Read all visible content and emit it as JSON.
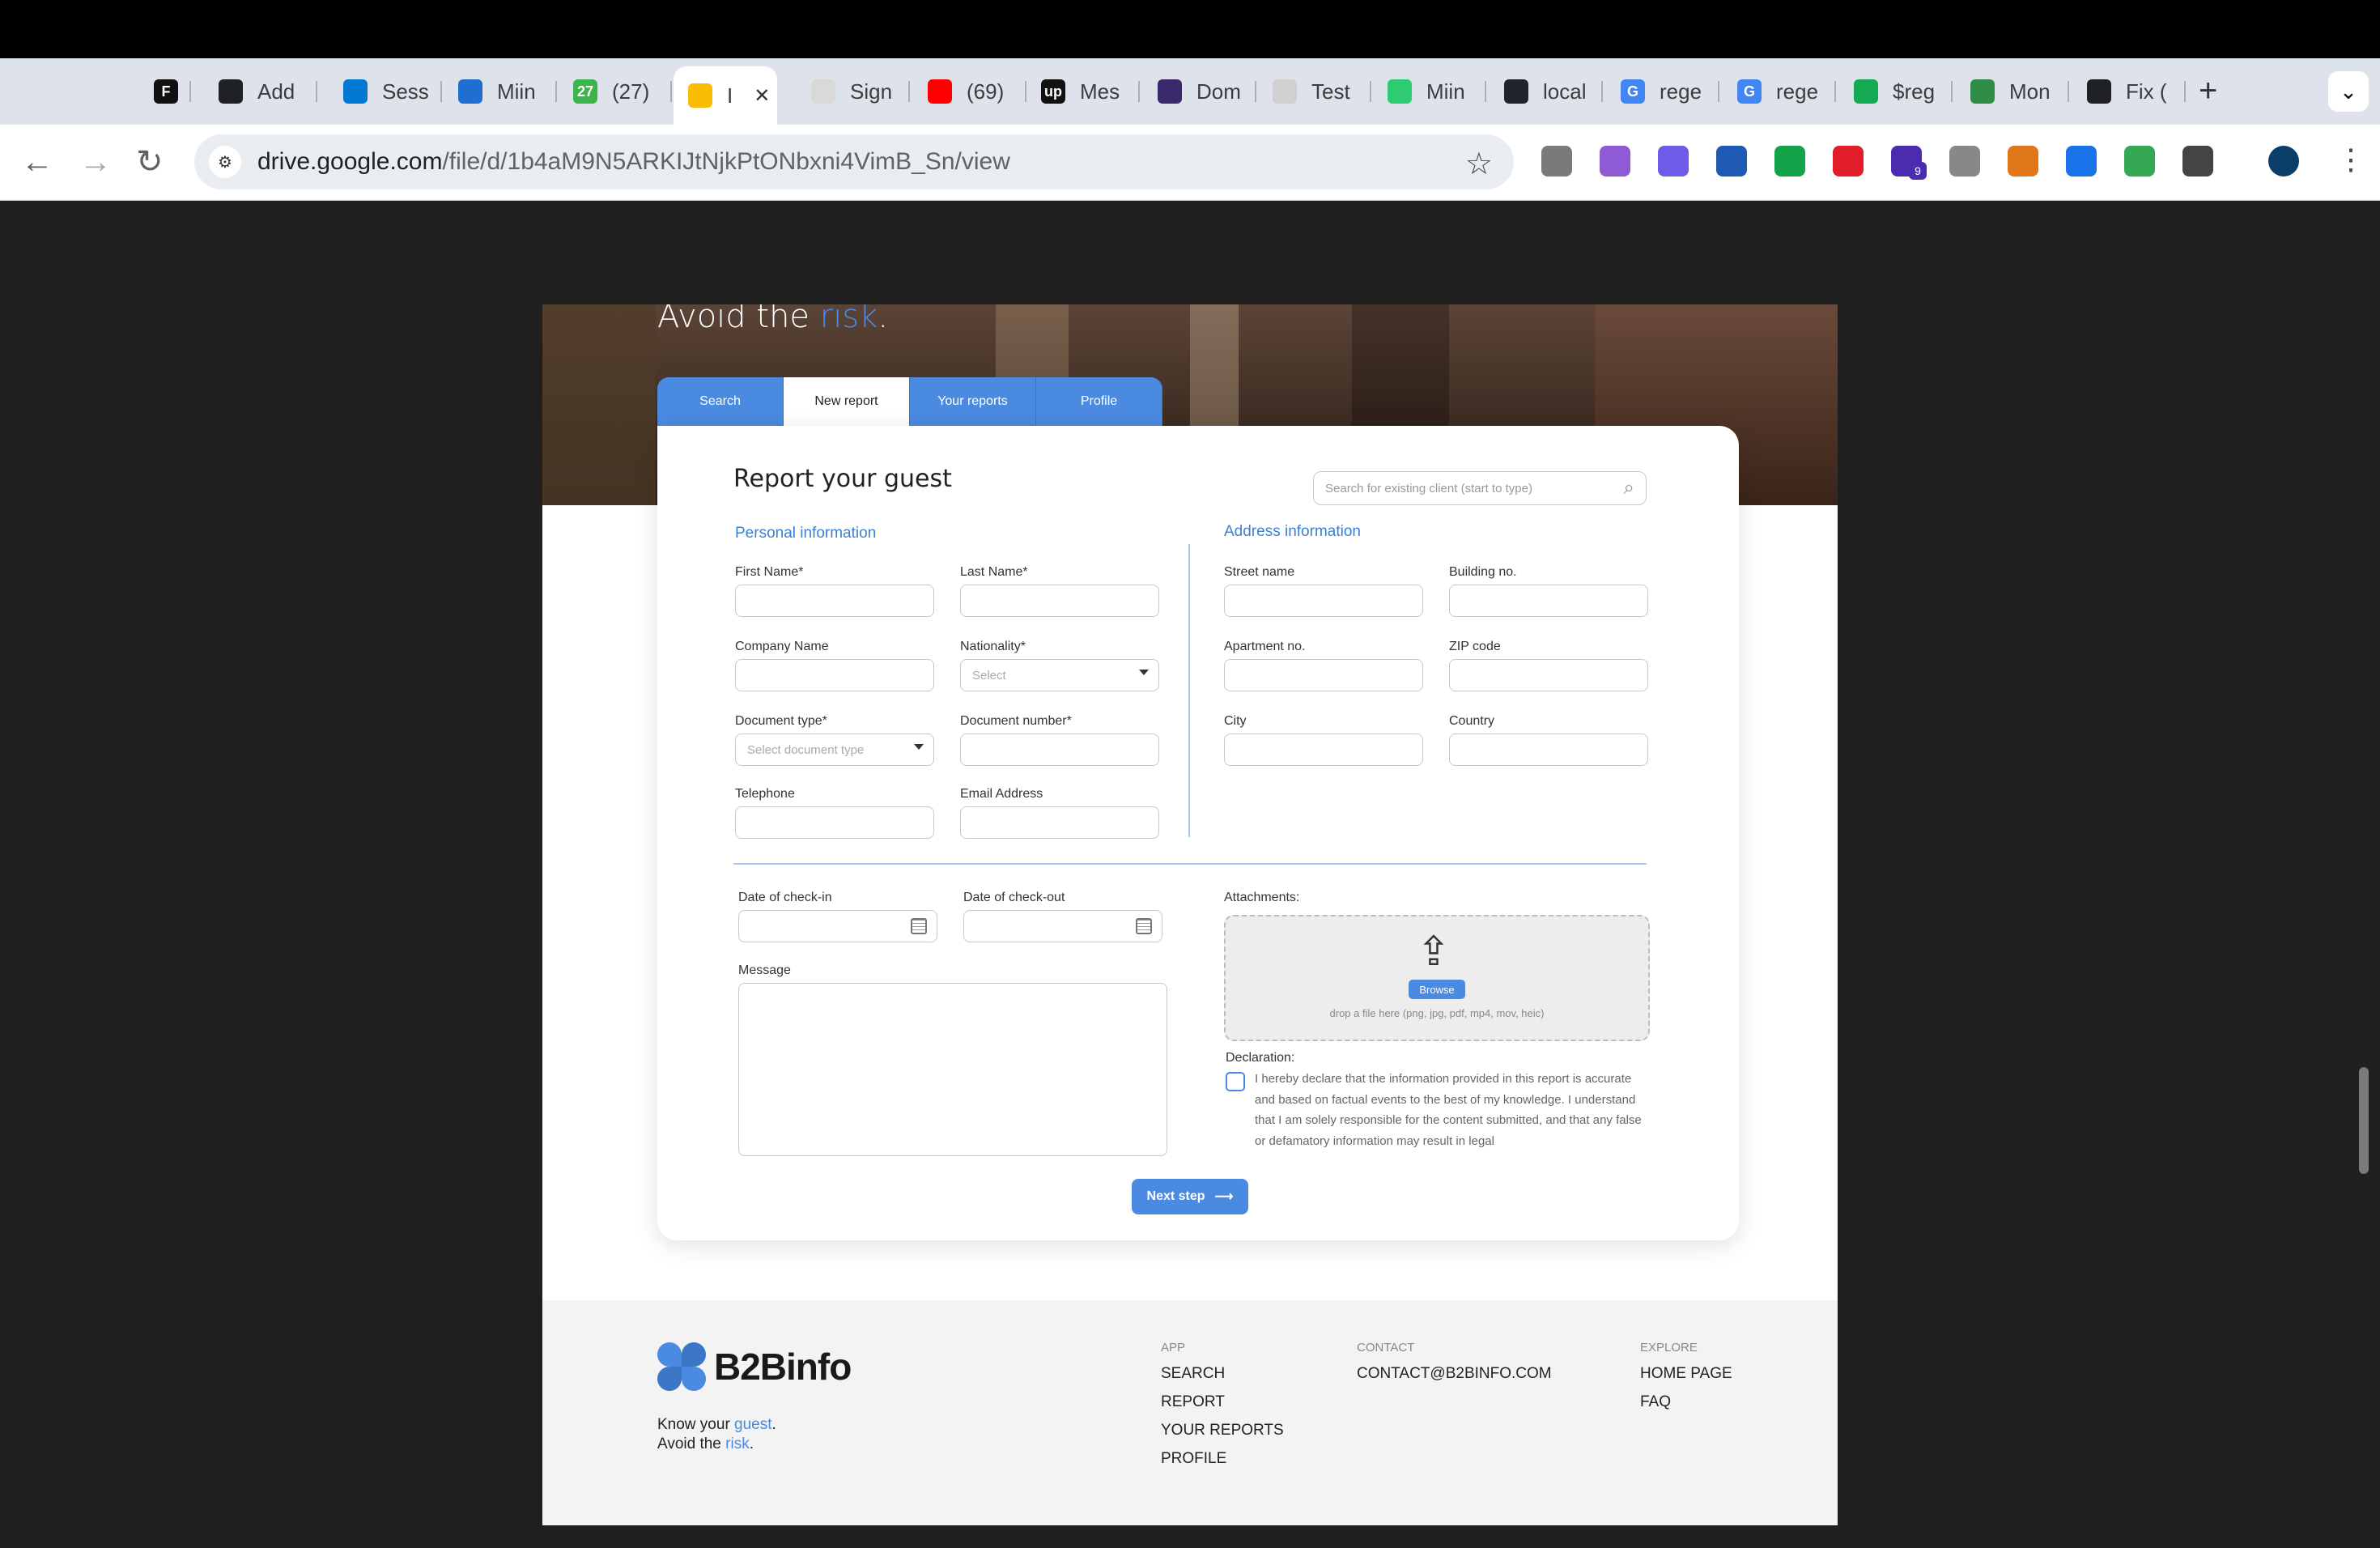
{
  "browser": {
    "tabs": [
      {
        "label": "",
        "favicon": "F",
        "color": "#111111"
      },
      {
        "label": "Add",
        "favicon": "chatgpt-icon",
        "color": "#202124"
      },
      {
        "label": "Sess",
        "favicon": "azure-icon",
        "color": "#0078d4"
      },
      {
        "label": "Miin",
        "favicon": "azure-devops-icon",
        "color": "#1e6fcf"
      },
      {
        "label": "(27)",
        "favicon": "27",
        "color": "#3bb54a"
      },
      {
        "label": "I",
        "favicon": "google-drive-icon",
        "color": "#fbbc04"
      },
      {
        "label": "Sign",
        "favicon": "sign-icon",
        "color": "#d9d9d9"
      },
      {
        "label": "(69)",
        "favicon": "youtube-icon",
        "color": "#ff0000"
      },
      {
        "label": "Mes",
        "favicon": "up",
        "color": "#111111"
      },
      {
        "label": "Dom",
        "favicon": "domain-icon",
        "color": "#3a2a6b"
      },
      {
        "label": "Test",
        "favicon": "test-icon",
        "color": "#d0d0d0"
      },
      {
        "label": "Miin",
        "favicon": "miin-icon",
        "color": "#2ecc71"
      },
      {
        "label": "local",
        "favicon": "react-icon",
        "color": "#20232a"
      },
      {
        "label": "rege",
        "favicon": "G",
        "color": "#4285f4"
      },
      {
        "label": "rege",
        "favicon": "G",
        "color": "#4285f4"
      },
      {
        "label": "$reg",
        "favicon": "mongodb-icon",
        "color": "#13aa52"
      },
      {
        "label": "Mon",
        "favicon": "geeks-icon",
        "color": "#2f8d46"
      },
      {
        "label": "Fix (",
        "favicon": "chatgpt-icon",
        "color": "#202124"
      }
    ],
    "active_tab_close": "✕",
    "new_tab": "+",
    "tab_menu": "⌄",
    "url_domain": "drive.google.com",
    "url_path": "/file/d/1b4aM9N5ARKIJtNjkPtONbxni4VimB_Sn/view",
    "extension_badge": "9"
  },
  "hero": {
    "tagline_prefix": "Avoid the ",
    "tagline_risk": "risk",
    "tagline_suffix": "."
  },
  "tabs": {
    "search": "Search",
    "new_report": "New report",
    "your_reports": "Your reports",
    "profile": "Profile"
  },
  "form": {
    "title": "Report your guest",
    "client_search_placeholder": "Search for existing client (start to type)",
    "personal_heading": "Personal information",
    "address_heading": "Address information",
    "first_name": "First Name*",
    "last_name": "Last Name*",
    "company_name": "Company Name",
    "nationality": "Nationality*",
    "nationality_placeholder": "Select",
    "document_type": "Document type*",
    "document_type_placeholder": "Select document type",
    "document_number": "Document number*",
    "telephone": "Telephone",
    "email": "Email Address",
    "street": "Street name",
    "building": "Building no.",
    "apartment": "Apartment no.",
    "zip": "ZIP code",
    "city": "City",
    "country": "Country",
    "checkin": "Date of check-in",
    "checkout": "Date of check-out",
    "message": "Message",
    "attachments": "Attachments:",
    "browse": "Browse",
    "drop_hint": "drop a file here (png, jpg, pdf, mp4, mov, heic)",
    "declaration": "Declaration:",
    "declaration_text": "I hereby declare that the information provided in this report is accurate and based on factual events to the best of my knowledge. I understand that I am solely responsible for the content submitted, and that any false or defamatory information may result in legal",
    "next_step": "Next step"
  },
  "footer": {
    "brand": "B2Binfo",
    "tag_line1_prefix": "Know your ",
    "tag_line1_hl": "guest",
    "tag_line1_suffix": ".",
    "tag_line2_prefix": "Avoid the ",
    "tag_line2_hl": "risk",
    "tag_line2_suffix": ".",
    "app_heading": "APP",
    "app_items": [
      "SEARCH",
      "REPORT",
      "YOUR REPORTS",
      "PROFILE"
    ],
    "contact_heading": "CONTACT",
    "contact_email": "CONTACT@B2BINFO.COM",
    "explore_heading": "EXPLORE",
    "explore_items": [
      "HOME PAGE",
      "FAQ"
    ]
  },
  "colors": {
    "accent": "#4a8ae0",
    "divider": "#a8c6ee"
  }
}
